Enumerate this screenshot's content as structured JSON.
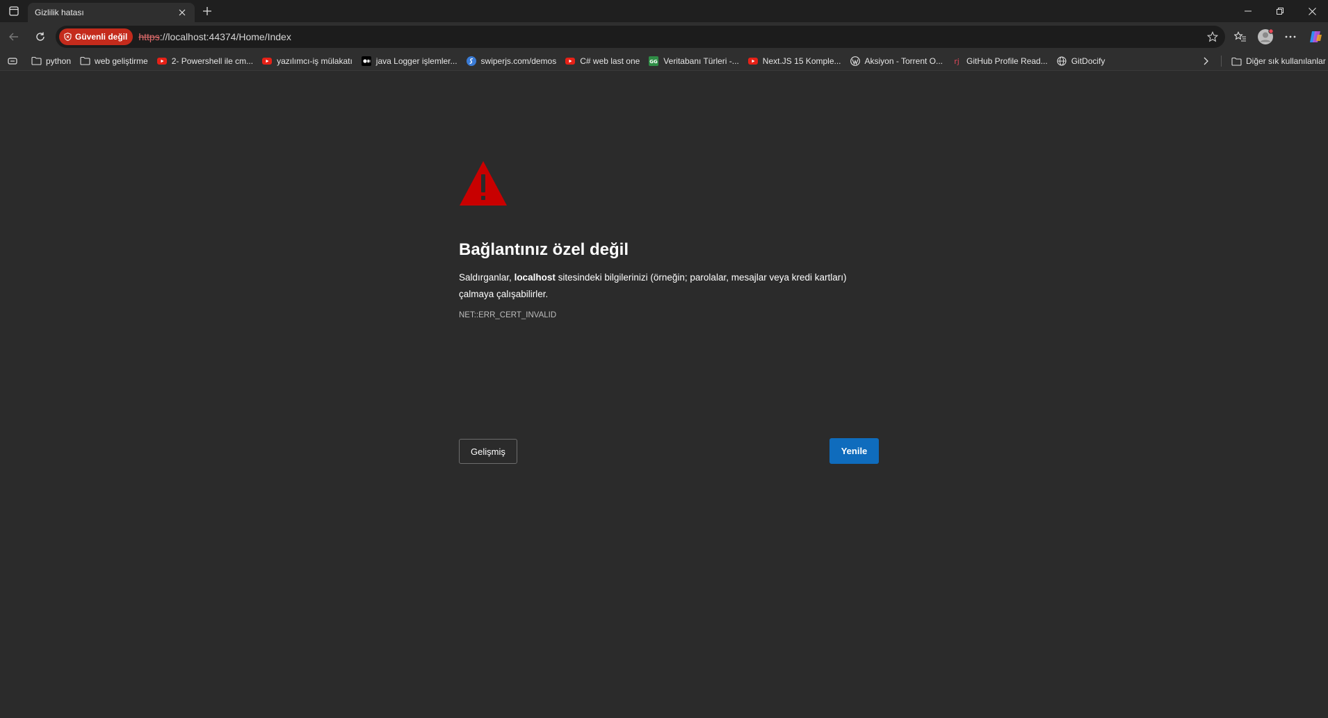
{
  "tab": {
    "title": "Gizlilik hatası"
  },
  "address_bar": {
    "security_label": "Güvenli değil",
    "url_scheme": "https",
    "url_rest": "://localhost:44374/Home/Index"
  },
  "bookmarks": [
    {
      "label": "python",
      "icon": "folder-icon"
    },
    {
      "label": "web geliştirme",
      "icon": "folder-icon"
    },
    {
      "label": "2- Powershell ile cm...",
      "icon": "youtube-icon"
    },
    {
      "label": "yazılımcı-iş mülakatı",
      "icon": "youtube-icon"
    },
    {
      "label": "java Logger işlemler...",
      "icon": "medium-icon"
    },
    {
      "label": "swiperjs.com/demos",
      "icon": "swiper-icon"
    },
    {
      "label": "C# web last one",
      "icon": "youtube-icon"
    },
    {
      "label": "Veritabanı Türleri -...",
      "icon": "gfg-icon"
    },
    {
      "label": "Next.JS 15 Komple...",
      "icon": "youtube-icon"
    },
    {
      "label": "Aksiyon - Torrent O...",
      "icon": "wordpress-icon"
    },
    {
      "label": "GitHub Profile Read...",
      "icon": "rj-icon"
    },
    {
      "label": "GitDocify",
      "icon": "globe-icon"
    }
  ],
  "other_bookmarks": {
    "label": "Diğer sık kullanılanlar"
  },
  "error": {
    "title": "Bağlantınız özel değil",
    "desc_prefix": "Saldırganlar, ",
    "desc_host": "localhost",
    "desc_suffix": " sitesindeki bilgilerinizi (örneğin; parolalar, mesajlar veya kredi kartları) çalmaya çalışabilirler.",
    "code": "NET::ERR_CERT_INVALID",
    "advanced_label": "Gelişmiş",
    "reload_label": "Yenile"
  },
  "colors": {
    "page_bg": "#2b2b2b",
    "warning_red": "#c80000",
    "security_chip": "#c42b1c",
    "primary_button": "#0f6cbd"
  }
}
